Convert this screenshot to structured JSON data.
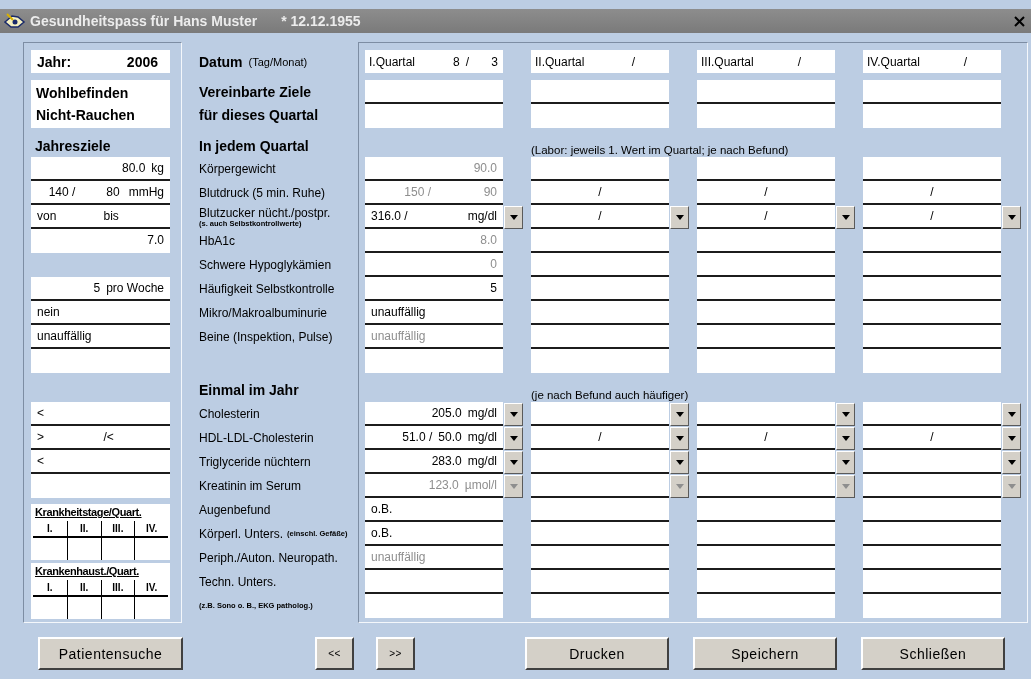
{
  "window": {
    "title": "Gesundheitspass für Hans Muster",
    "birth": "* 12.12.1955"
  },
  "summary": {
    "year_label": "Jahr:",
    "year": "2006",
    "goals": [
      "Wohlbefinden",
      "Nicht-Rauchen"
    ],
    "targets_heading": "Jahresziele"
  },
  "datum": {
    "label": "Datum",
    "note": "(Tag/Monat)"
  },
  "goals_heading": "Vereinbarte Ziele für dieses Quartal",
  "sections": [
    {
      "heading": "In jedem Quartal",
      "note": "(Labor: jeweils 1. Wert im Quartal; je nach Befund)",
      "rows": [
        {
          "kind": "plain",
          "label": "Körpergewicht"
        },
        {
          "kind": "plain",
          "label": "Blutdruck (5 min. Ruhe)"
        },
        {
          "kind": "stacked",
          "label": "Blutzucker nücht./postpr.",
          "note": "(s. auch Selbstkontrollwerte)",
          "dropdown": {
            "disabled": false
          }
        },
        {
          "kind": "plain",
          "label": "HbA1c"
        },
        {
          "kind": "plain",
          "label": "Schwere Hypoglykämien"
        },
        {
          "kind": "plain",
          "label": "Häufigkeit Selbstkontrolle"
        },
        {
          "kind": "plain",
          "label": "Mikro/Makroalbuminurie"
        },
        {
          "kind": "plain",
          "label": "Beine (Inspektion, Pulse)"
        },
        {
          "kind": "plain"
        }
      ],
      "targets": [
        {
          "kind": "right",
          "parts": [
            "80.0",
            "kg"
          ]
        },
        {
          "kind": "columns",
          "parts": [
            "140 /",
            "80",
            "mmHg"
          ]
        },
        {
          "kind": "grid",
          "parts": [
            "von",
            "bis"
          ]
        },
        {
          "kind": "right",
          "parts": [
            "7.0"
          ]
        },
        {
          "kind": "gap"
        },
        {
          "kind": "right",
          "parts": [
            "5",
            "pro Woche"
          ]
        },
        {
          "kind": "left",
          "parts": [
            "nein"
          ]
        },
        {
          "kind": "left",
          "parts": [
            "unauffällig"
          ]
        },
        {
          "kind": "blank"
        }
      ]
    },
    {
      "heading": "Einmal im Jahr",
      "note": "(je nach Befund auch häufiger)",
      "rows": [
        {
          "kind": "plain",
          "label": "Cholesterin",
          "dropdown": {
            "disabled": false
          }
        },
        {
          "kind": "plain",
          "label": "HDL-LDL-Cholesterin",
          "dropdown": {
            "disabled": false
          }
        },
        {
          "kind": "plain",
          "label": "Triglyceride nüchtern",
          "dropdown": {
            "disabled": false
          }
        },
        {
          "kind": "plain",
          "label": "Kreatinin im Serum",
          "dropdown": {
            "disabled": true
          }
        },
        {
          "kind": "plain",
          "label": "Augenbefund"
        },
        {
          "kind": "inline",
          "label": "Körperl. Unters.",
          "note": "(einschl. Gefäße)"
        },
        {
          "kind": "plain",
          "label": "Periph./Auton. Neuropath."
        },
        {
          "kind": "plain",
          "label": "Techn. Unters."
        },
        {
          "kind": "stacked",
          "note": "(z.B. Sono o. B., EKG patholog.)"
        }
      ],
      "targets": [
        {
          "kind": "left",
          "parts": [
            "<"
          ]
        },
        {
          "kind": "grid",
          "parts": [
            ">",
            "/<"
          ]
        },
        {
          "kind": "left",
          "parts": [
            "<"
          ]
        },
        {
          "kind": "blank"
        }
      ]
    }
  ],
  "quarters": [
    {
      "header": "I.Quartal",
      "day": "8",
      "separator": "/",
      "month": "3",
      "sections": [
        {
          "cells": [
            {
              "kind": "right",
              "parts": [
                "90.0"
              ],
              "dimmed": true
            },
            {
              "kind": "columns",
              "parts": [
                "150 /",
                "90"
              ],
              "dimmed": true
            },
            {
              "kind": "spread",
              "parts": [
                "316.0 /",
                "mg/dl"
              ],
              "dimmed": false
            },
            {
              "kind": "right",
              "parts": [
                "8.0"
              ],
              "dimmed": true
            },
            {
              "kind": "right",
              "parts": [
                "0"
              ],
              "dimmed": true
            },
            {
              "kind": "right",
              "parts": [
                "5"
              ],
              "dimmed": false
            },
            {
              "kind": "left",
              "parts": [
                "unauffällig"
              ],
              "dimmed": false
            },
            {
              "kind": "left",
              "parts": [
                "unauffällig"
              ],
              "dimmed": true
            },
            {
              "kind": "blank"
            }
          ]
        },
        {
          "cells": [
            {
              "kind": "right",
              "parts": [
                "205.0",
                "mg/dl"
              ],
              "dimmed": false
            },
            {
              "kind": "right",
              "parts": [
                "51.0 /",
                "50.0",
                "mg/dl"
              ],
              "dimmed": false
            },
            {
              "kind": "right",
              "parts": [
                "283.0",
                "mg/dl"
              ],
              "dimmed": false
            },
            {
              "kind": "right",
              "parts": [
                "123.0",
                "µmol/l"
              ],
              "dimmed": true
            },
            {
              "kind": "left",
              "parts": [
                "o.B."
              ],
              "dimmed": false
            },
            {
              "kind": "left",
              "parts": [
                "o.B."
              ],
              "dimmed": false
            },
            {
              "kind": "left",
              "parts": [
                "unauffällig"
              ],
              "dimmed": true
            },
            {
              "kind": "blank"
            },
            {
              "kind": "blank"
            }
          ]
        }
      ]
    },
    {
      "header": "II.Quartal",
      "separator": "/",
      "sections": [
        {
          "cells": [
            {
              "kind": "blank"
            },
            {
              "kind": "center",
              "parts": [
                "/"
              ],
              "dimmed": false
            },
            {
              "kind": "center",
              "parts": [
                "/"
              ],
              "dimmed": false
            },
            {
              "kind": "blank"
            },
            {
              "kind": "blank"
            },
            {
              "kind": "blank"
            },
            {
              "kind": "blank"
            },
            {
              "kind": "blank"
            },
            {
              "kind": "blank"
            }
          ]
        },
        {
          "cells": [
            {
              "kind": "blank"
            },
            {
              "kind": "center",
              "parts": [
                "/"
              ],
              "dimmed": false
            },
            {
              "kind": "blank"
            },
            {
              "kind": "blank"
            },
            {
              "kind": "blank"
            },
            {
              "kind": "blank"
            },
            {
              "kind": "blank"
            },
            {
              "kind": "blank"
            },
            {
              "kind": "blank"
            }
          ]
        }
      ]
    },
    {
      "header": "III.Quartal",
      "separator": "/",
      "sections": [
        {
          "cells": [
            {
              "kind": "blank"
            },
            {
              "kind": "center",
              "parts": [
                "/"
              ],
              "dimmed": false
            },
            {
              "kind": "center",
              "parts": [
                "/"
              ],
              "dimmed": false
            },
            {
              "kind": "blank"
            },
            {
              "kind": "blank"
            },
            {
              "kind": "blank"
            },
            {
              "kind": "blank"
            },
            {
              "kind": "blank"
            },
            {
              "kind": "blank"
            }
          ]
        },
        {
          "cells": [
            {
              "kind": "blank"
            },
            {
              "kind": "center",
              "parts": [
                "/"
              ],
              "dimmed": false
            },
            {
              "kind": "blank"
            },
            {
              "kind": "blank"
            },
            {
              "kind": "blank"
            },
            {
              "kind": "blank"
            },
            {
              "kind": "blank"
            },
            {
              "kind": "blank"
            },
            {
              "kind": "blank"
            }
          ]
        }
      ]
    },
    {
      "header": "IV.Quartal",
      "separator": "/",
      "sections": [
        {
          "cells": [
            {
              "kind": "blank"
            },
            {
              "kind": "center",
              "parts": [
                "/"
              ],
              "dimmed": false
            },
            {
              "kind": "center",
              "parts": [
                "/"
              ],
              "dimmed": false
            },
            {
              "kind": "blank"
            },
            {
              "kind": "blank"
            },
            {
              "kind": "blank"
            },
            {
              "kind": "blank"
            },
            {
              "kind": "blank"
            },
            {
              "kind": "blank"
            }
          ]
        },
        {
          "cells": [
            {
              "kind": "blank"
            },
            {
              "kind": "center",
              "parts": [
                "/"
              ],
              "dimmed": false
            },
            {
              "kind": "blank"
            },
            {
              "kind": "blank"
            },
            {
              "kind": "blank"
            },
            {
              "kind": "blank"
            },
            {
              "kind": "blank"
            },
            {
              "kind": "blank"
            },
            {
              "kind": "blank"
            }
          ]
        }
      ]
    }
  ],
  "left_tables": [
    {
      "title": "Krankheitstage/Quart.",
      "columns": [
        "I.",
        "II.",
        "III.",
        "IV."
      ]
    },
    {
      "title": "Krankenhaust./Quart.",
      "columns": [
        "I.",
        "II.",
        "III.",
        "IV."
      ]
    }
  ],
  "button_groups": [
    {
      "kind": "search",
      "buttons": [
        "Patientensuche"
      ]
    },
    {
      "kind": "navigation",
      "buttons": [
        "<<",
        ">>"
      ]
    },
    {
      "kind": "actions",
      "buttons": [
        "Drucken",
        "Speichern",
        "Schließen"
      ]
    }
  ]
}
